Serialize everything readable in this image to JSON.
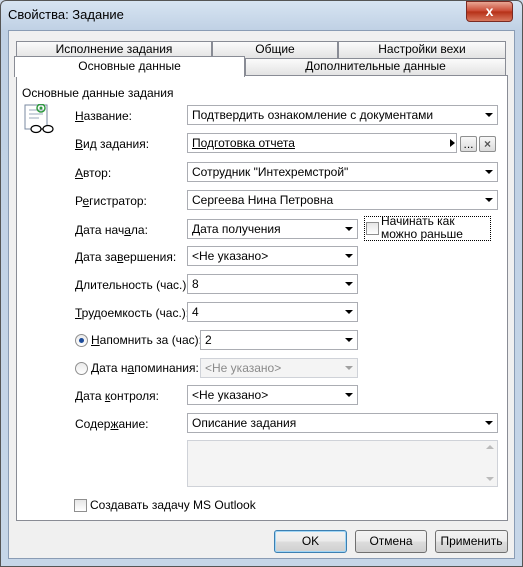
{
  "window": {
    "title": "Свойства: Задание",
    "close": "x"
  },
  "tabs": {
    "top": [
      "Исполнение задания",
      "Общие",
      "Настройки вехи"
    ],
    "bottom": [
      "Основные данные",
      "Дополнительные данные"
    ],
    "active": "Основные данные"
  },
  "group_title": "Основные данные задания",
  "fields": {
    "name": {
      "label": "Название:",
      "value": "Подтвердить ознакомление с документами"
    },
    "task_type": {
      "label": "Вид задания:",
      "value": "Подготовка отчета",
      "ellipsis": "...",
      "clear": "×"
    },
    "author": {
      "label": "Автор:",
      "value": "Сотрудник \"Интехремстрой\""
    },
    "registrar": {
      "label": "Регистратор:",
      "value": "Сергеева Нина Петровна"
    },
    "start_date": {
      "label": "Дата начала:",
      "value": "Дата получения"
    },
    "start_asap": {
      "label": "Начинать как можно раньше",
      "checked": false
    },
    "end_date": {
      "label": "Дата завершения:",
      "value": "<Не указано>"
    },
    "duration": {
      "label": "Длительность (час.):",
      "value": "8"
    },
    "effort": {
      "label": "Трудоемкость (час.):",
      "value": "4"
    },
    "remind_in": {
      "label": "Напомнить за (час):",
      "value": "2",
      "selected": true
    },
    "remind_date": {
      "label": "Дата напоминания:",
      "value": "<Не указано>",
      "selected": false
    },
    "control_date": {
      "label": "Дата контроля:",
      "value": "<Не указано>"
    },
    "content": {
      "label": "Содержание:",
      "value": "Описание задания",
      "text": ""
    }
  },
  "outlook": {
    "label": "Создавать задачу MS Outlook",
    "checked": false
  },
  "buttons": {
    "ok": "OK",
    "cancel": "Отмена",
    "apply": "Применить"
  }
}
